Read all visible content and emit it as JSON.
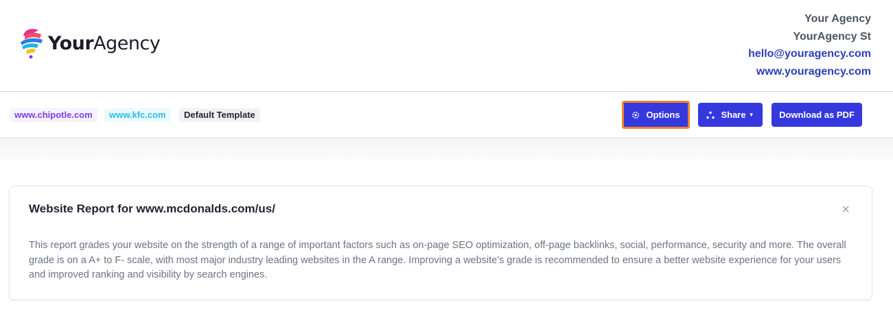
{
  "logo": {
    "text_bold": "Your",
    "text_regular": "Agency"
  },
  "agency": {
    "name": "Your Agency",
    "street": "YourAgency St",
    "email": "hello@youragency.com",
    "website": "www.youragency.com"
  },
  "toolbar": {
    "chips": [
      "www.chipotle.com",
      "www.kfc.com",
      "Default Template"
    ],
    "options_label": "Options",
    "share_label": "Share",
    "download_label": "Download as PDF"
  },
  "report": {
    "title": "Website Report for www.mcdonalds.com/us/",
    "close_label": "×",
    "description": "This report grades your website on the strength of a range of important factors such as on-page SEO optimization, off-page backlinks, social, performance, security and more. The overall grade is on a A+ to F- scale, with most major industry leading websites in the A range. Improving a website's grade is recommended to ensure a better website experience for your users and improved ranking and visibility by search engines."
  },
  "colors": {
    "primary_button": "#3538dd",
    "highlight_outline": "#f4812b",
    "agency_link": "#2d40b8"
  },
  "icons": {
    "options": "gear-icon",
    "share": "share-icon",
    "close": "close-icon"
  }
}
